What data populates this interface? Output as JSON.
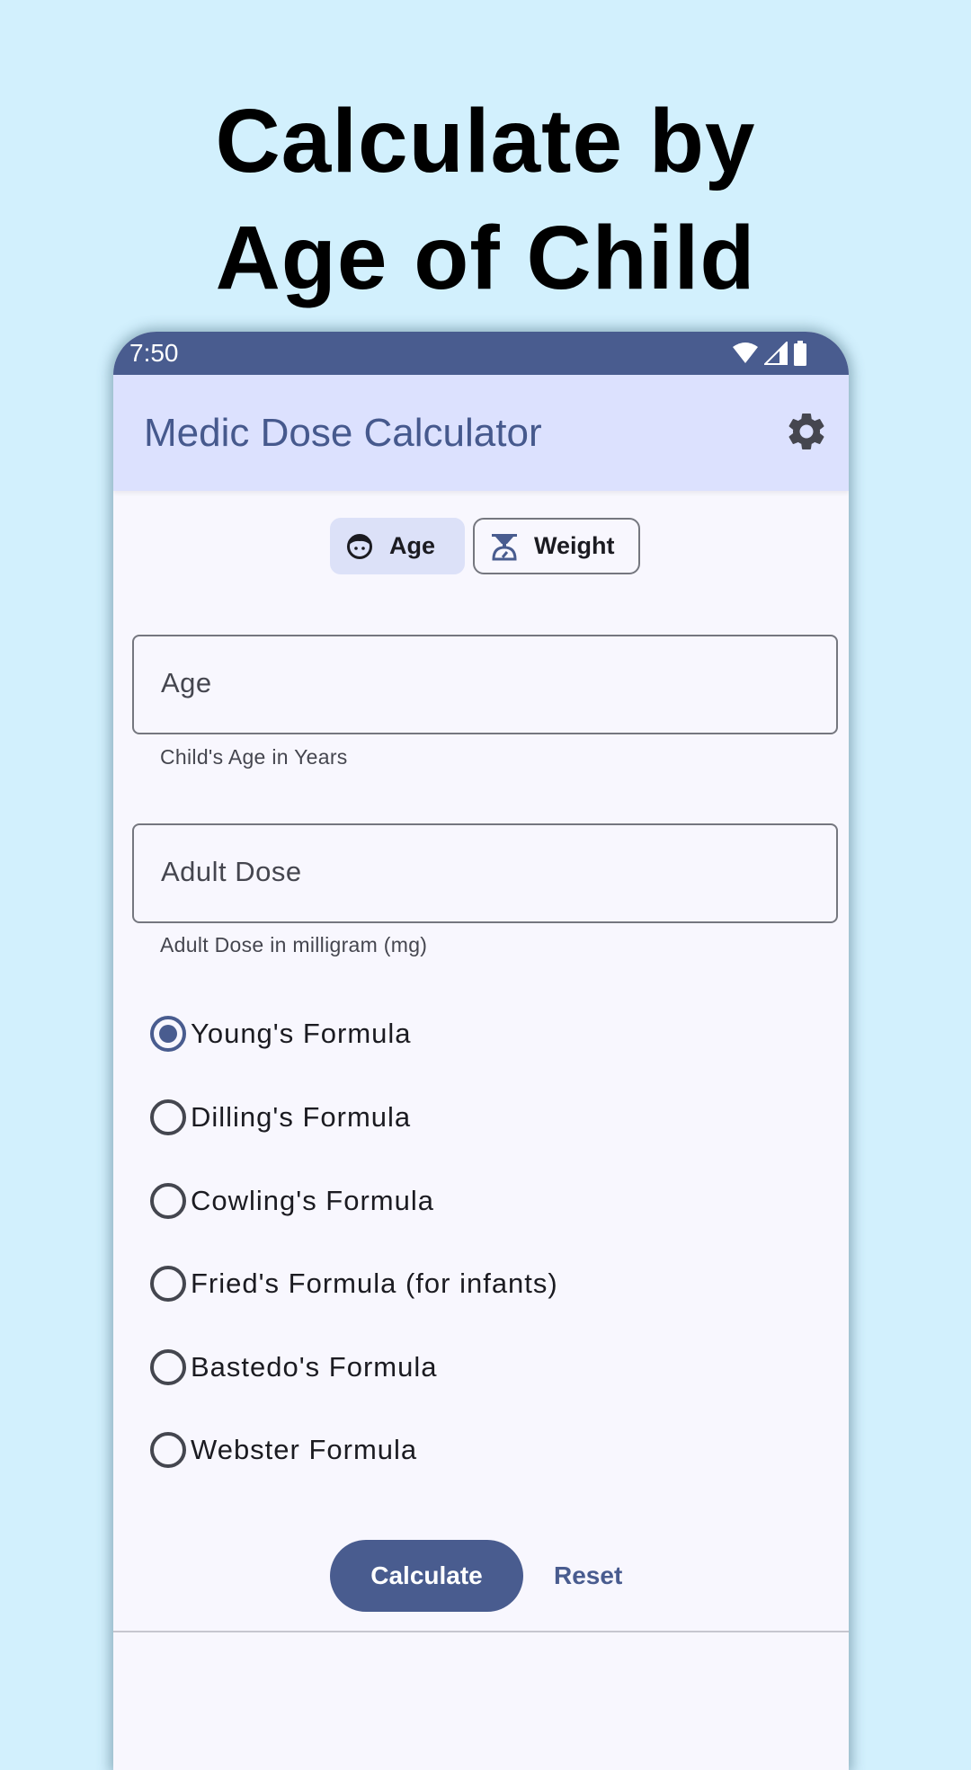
{
  "promo": {
    "line1": "Calculate by",
    "line2": "Age of Child"
  },
  "status_bar": {
    "time": "7:50",
    "icons": [
      "wifi-icon",
      "cellular-signal-icon",
      "battery-icon"
    ]
  },
  "app_bar": {
    "title": "Medic Dose Calculator",
    "settings_icon": "gear-icon"
  },
  "mode_toggle": {
    "options": [
      {
        "label": "Age",
        "icon": "child-face-icon",
        "selected": true
      },
      {
        "label": "Weight",
        "icon": "scale-icon",
        "selected": false
      }
    ]
  },
  "fields": [
    {
      "label": "Age",
      "value": "",
      "helper": "Child's Age in Years"
    },
    {
      "label": "Adult Dose",
      "value": "",
      "helper": "Adult Dose in milligram (mg)"
    }
  ],
  "formulas": [
    {
      "label": "Young's Formula",
      "selected": true
    },
    {
      "label": "Dilling's Formula",
      "selected": false
    },
    {
      "label": "Cowling's Formula",
      "selected": false
    },
    {
      "label": "Fried's Formula (for infants)",
      "selected": false
    },
    {
      "label": "Bastedo's Formula",
      "selected": false
    },
    {
      "label": "Webster Formula",
      "selected": false
    }
  ],
  "actions": {
    "calculate_label": "Calculate",
    "reset_label": "Reset"
  },
  "colors": {
    "primary": "#495c8f",
    "app_bar_bg": "#dce1fe",
    "page_bg": "#d2f0fd",
    "surface": "#f8f7fe"
  }
}
